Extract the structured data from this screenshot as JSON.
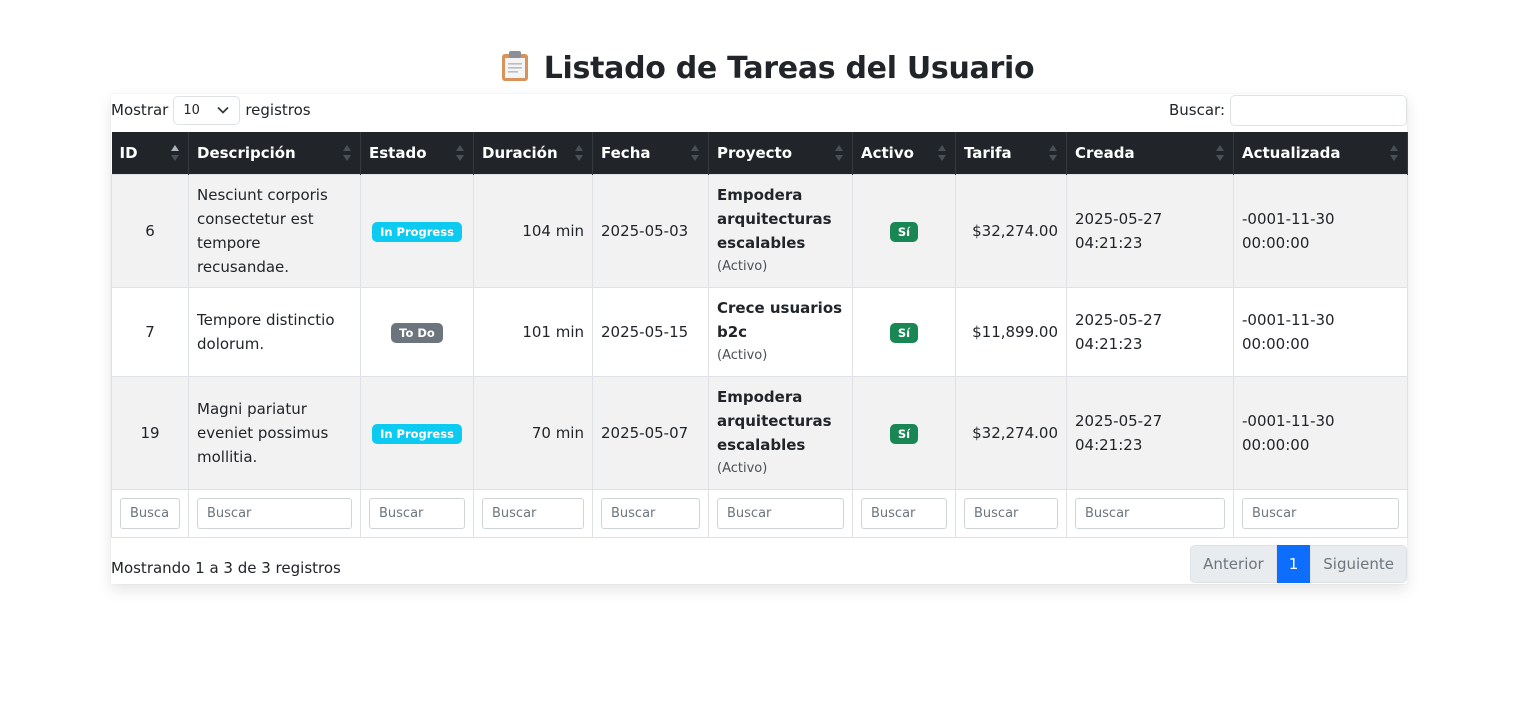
{
  "page": {
    "title": "Listado de Tareas del Usuario",
    "title_icon": "clipboard-icon"
  },
  "length_control": {
    "label_before": "Mostrar",
    "selected": "10",
    "label_after": "registros"
  },
  "search": {
    "label": "Buscar:",
    "value": ""
  },
  "columns": [
    "ID",
    "Descripción",
    "Estado",
    "Duración",
    "Fecha",
    "Proyecto",
    "Activo",
    "Tarifa",
    "Creada",
    "Actualizada"
  ],
  "rows": [
    {
      "id": "6",
      "description": "Nesciunt corporis consectetur est tempore recusandae.",
      "status": "In Progress",
      "duration": "104 min",
      "date": "2025-05-03",
      "project": "Empodera arquitecturas escalables",
      "project_status": "(Activo)",
      "active": "Sí",
      "rate": "$32,274.00",
      "created": "2025-05-27 04:21:23",
      "updated": "-0001-11-30 00:00:00"
    },
    {
      "id": "7",
      "description": "Tempore distinctio dolorum.",
      "status": "To Do",
      "duration": "101 min",
      "date": "2025-05-15",
      "project": "Crece usuarios b2c",
      "project_status": "(Activo)",
      "active": "Sí",
      "rate": "$11,899.00",
      "created": "2025-05-27 04:21:23",
      "updated": "-0001-11-30 00:00:00"
    },
    {
      "id": "19",
      "description": "Magni pariatur eveniet possimus mollitia.",
      "status": "In Progress",
      "duration": "70 min",
      "date": "2025-05-07",
      "project": "Empodera arquitecturas escalables",
      "project_status": "(Activo)",
      "active": "Sí",
      "rate": "$32,274.00",
      "created": "2025-05-27 04:21:23",
      "updated": "-0001-11-30 00:00:00"
    }
  ],
  "filters": {
    "placeholder": "Buscar"
  },
  "footer": {
    "info": "Mostrando 1 a 3 de 3 registros"
  },
  "pagination": {
    "prev": "Anterior",
    "current": "1",
    "next": "Siguiente"
  },
  "colors": {
    "header_bg": "#212529",
    "status_in_progress": "#0dcaf0",
    "status_todo": "#6c757d",
    "active_badge": "#198754",
    "pagination_active": "#0d6efd"
  }
}
